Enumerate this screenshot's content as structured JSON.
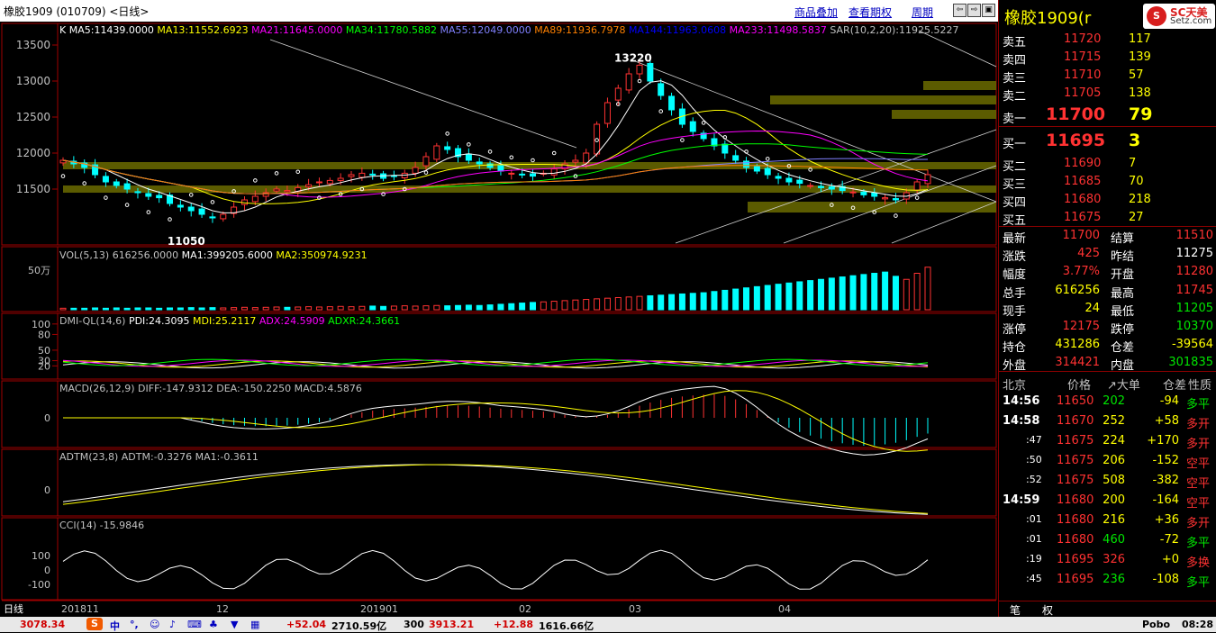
{
  "title": {
    "text": "橡胶1909 (010709) <日线>",
    "links": [
      "商品叠加",
      "查看期权",
      "周期"
    ]
  },
  "chart_data": [
    {
      "type": "candlestick",
      "title": "K",
      "indicators": [
        {
          "name": "MA5",
          "value": "11439.0000",
          "color": "#ffffff"
        },
        {
          "name": "MA13",
          "value": "11552.6923",
          "color": "#ffff00"
        },
        {
          "name": "MA21",
          "value": "11645.0000",
          "color": "#ff00ff"
        },
        {
          "name": "MA34",
          "value": "11780.5882",
          "color": "#00ff00"
        },
        {
          "name": "MA55",
          "value": "12049.0000",
          "color": "#8080ff"
        },
        {
          "name": "MA89",
          "value": "11936.7978",
          "color": "#ff8000"
        },
        {
          "name": "MA144",
          "value": "11963.0608",
          "color": "#0000ff"
        },
        {
          "name": "MA233",
          "value": "11498.5837",
          "color": "#ff00ff"
        },
        {
          "name": "SAR(10,2,20)",
          "value": "11925.5227",
          "color": "#c0c0c0"
        }
      ],
      "yticks": [
        13500,
        13000,
        12500,
        12000,
        11500
      ],
      "ylim": [
        10750,
        13650
      ],
      "annotations": [
        {
          "text": "13220"
        },
        {
          "text": "11050"
        }
      ],
      "x_labels": [
        "日线",
        "201811",
        "12",
        "201901",
        "02",
        "03",
        "04"
      ],
      "closes": [
        11900,
        11850,
        11800,
        11700,
        11600,
        11550,
        11500,
        11450,
        11400,
        11380,
        11300,
        11250,
        11200,
        11150,
        11100,
        11150,
        11250,
        11350,
        11400,
        11450,
        11500,
        11480,
        11520,
        11560,
        11600,
        11620,
        11650,
        11700,
        11720,
        11700,
        11650,
        11680,
        11720,
        11800,
        11950,
        12100,
        12050,
        11950,
        11900,
        11850,
        11800,
        11750,
        11720,
        11700,
        11680,
        11720,
        11780,
        11850,
        11900,
        12000,
        12400,
        12700,
        12900,
        13100,
        13220,
        13000,
        12800,
        12600,
        12400,
        12300,
        12200,
        12100,
        12000,
        11900,
        11800,
        11750,
        11700,
        11650,
        11600,
        11580,
        11550,
        11520,
        11500,
        11480,
        11460,
        11420,
        11400,
        11380,
        11350,
        11450,
        11600,
        11700
      ]
    },
    {
      "type": "bar",
      "title": "VOL(5,13)",
      "indicators": [
        {
          "name": "VOL(5,13)",
          "value": "616256.0000",
          "color": "#c0c0c0"
        },
        {
          "name": "MA1",
          "value": "399205.6000",
          "color": "#ffffff"
        },
        {
          "name": "MA2",
          "value": "350974.9231",
          "color": "#ffff00"
        }
      ],
      "yticks_label": "50万",
      "values": [
        5,
        5,
        5,
        6,
        5,
        6,
        5,
        6,
        6,
        5,
        6,
        6,
        7,
        6,
        7,
        6,
        7,
        8,
        7,
        8,
        9,
        8,
        9,
        10,
        9,
        10,
        11,
        10,
        11,
        12,
        11,
        12,
        13,
        12,
        13,
        14,
        13,
        14,
        15,
        14,
        16,
        18,
        20,
        22,
        24,
        26,
        28,
        30,
        32,
        34,
        36,
        38,
        40,
        42,
        44,
        46,
        48,
        50,
        52,
        54,
        56,
        60,
        64,
        68,
        72,
        76,
        80,
        84,
        88,
        92,
        96,
        100,
        104,
        108,
        112,
        116,
        120,
        124,
        110,
        100,
        120,
        140
      ],
      "ylim": [
        0,
        160
      ]
    },
    {
      "type": "line",
      "title": "DMI-QL(14,6)",
      "indicators": [
        {
          "name": "PDI",
          "value": "24.3095",
          "color": "#ffffff"
        },
        {
          "name": "MDI",
          "value": "25.2117",
          "color": "#ffff00"
        },
        {
          "name": "ADX",
          "value": "24.5909",
          "color": "#ff00ff"
        },
        {
          "name": "ADXR",
          "value": "24.3661",
          "color": "#00ff00"
        }
      ],
      "yticks": [
        100,
        80,
        50,
        30,
        20
      ],
      "ylim": [
        0,
        110
      ]
    },
    {
      "type": "line",
      "title": "MACD(26,12,9)",
      "indicators": [
        {
          "name": "DIFF",
          "value": "-147.9312",
          "color": "#ffffff"
        },
        {
          "name": "DEA",
          "value": "-150.2250",
          "color": "#ffff00"
        },
        {
          "name": "MACD",
          "value": "4.5876",
          "color": "#ff00ff"
        }
      ],
      "yticks": [
        0
      ]
    },
    {
      "type": "line",
      "title": "ADTM(23,8)",
      "indicators": [
        {
          "name": "ADTM",
          "value": "-0.3276",
          "color": "#ffffff"
        },
        {
          "name": "MA1",
          "value": "-0.3611",
          "color": "#ffff00"
        }
      ],
      "yticks": [
        0
      ]
    },
    {
      "type": "line",
      "title": "CCI(14)",
      "indicators": [
        {
          "name": "CCI(14)",
          "value": "-15.9846",
          "color": "#c0c0c0"
        }
      ],
      "yticks": [
        100,
        0,
        -100
      ]
    }
  ],
  "quote": {
    "product": "橡胶1909(r",
    "logo_text": "SC天美",
    "logo_sub": "Setz.com",
    "asks": [
      {
        "label": "卖五",
        "price": "11720",
        "vol": "117"
      },
      {
        "label": "卖四",
        "price": "11715",
        "vol": "139"
      },
      {
        "label": "卖三",
        "price": "11710",
        "vol": "57"
      },
      {
        "label": "卖二",
        "price": "11705",
        "vol": "138"
      },
      {
        "label": "卖一",
        "price": "11700",
        "vol": "79"
      }
    ],
    "bids": [
      {
        "label": "买一",
        "price": "11695",
        "vol": "3"
      },
      {
        "label": "买二",
        "price": "11690",
        "vol": "7"
      },
      {
        "label": "买三",
        "price": "11685",
        "vol": "70"
      },
      {
        "label": "买四",
        "price": "11680",
        "vol": "218"
      },
      {
        "label": "买五",
        "price": "11675",
        "vol": "27"
      }
    ],
    "stats": [
      {
        "l1": "最新",
        "v1": "11700",
        "c1": "red",
        "l2": "结算",
        "v2": "11510",
        "c2": "red"
      },
      {
        "l1": "涨跌",
        "v1": "425",
        "c1": "red",
        "l2": "昨结",
        "v2": "11275",
        "c2": "white"
      },
      {
        "l1": "幅度",
        "v1": "3.77%",
        "c1": "red",
        "l2": "开盘",
        "v2": "11280",
        "c2": "red"
      },
      {
        "l1": "总手",
        "v1": "616256",
        "c1": "yellow",
        "l2": "最高",
        "v2": "11745",
        "c2": "red"
      },
      {
        "l1": "现手",
        "v1": "24",
        "c1": "yellow",
        "l2": "最低",
        "v2": "11205",
        "c2": "green"
      },
      {
        "l1": "涨停",
        "v1": "12175",
        "c1": "red",
        "l2": "跌停",
        "v2": "10370",
        "c2": "green"
      },
      {
        "l1": "持仓",
        "v1": "431286",
        "c1": "yellow",
        "l2": "仓差",
        "v2": "-39564",
        "c2": "yellow"
      },
      {
        "l1": "外盘",
        "v1": "314421",
        "c1": "red",
        "l2": "内盘",
        "v2": "301835",
        "c2": "green"
      }
    ],
    "ticks_header": [
      "北京",
      "价格",
      "↗大单",
      "仓差",
      "性质"
    ],
    "ticks": [
      {
        "time": "14:56",
        "price": "11650",
        "vol": "202",
        "vc": "green",
        "diff": "-94",
        "dc": "yellow",
        "nature": "多平",
        "nc": "green"
      },
      {
        "time": "14:58",
        "price": "11670",
        "vol": "252",
        "vc": "yellow",
        "diff": "+58",
        "dc": "yellow",
        "nature": "多开",
        "nc": "red"
      },
      {
        "time": ":47",
        "price": "11675",
        "vol": "224",
        "vc": "yellow",
        "diff": "+170",
        "dc": "yellow",
        "nature": "多开",
        "nc": "red"
      },
      {
        "time": ":50",
        "price": "11675",
        "vol": "206",
        "vc": "yellow",
        "diff": "-152",
        "dc": "yellow",
        "nature": "空平",
        "nc": "red"
      },
      {
        "time": ":52",
        "price": "11675",
        "vol": "508",
        "vc": "yellow",
        "diff": "-382",
        "dc": "yellow",
        "nature": "空平",
        "nc": "red"
      },
      {
        "time": "14:59",
        "price": "11680",
        "vol": "200",
        "vc": "yellow",
        "diff": "-164",
        "dc": "yellow",
        "nature": "空平",
        "nc": "red"
      },
      {
        "time": ":01",
        "price": "11680",
        "vol": "216",
        "vc": "yellow",
        "diff": "+36",
        "dc": "yellow",
        "nature": "多开",
        "nc": "red"
      },
      {
        "time": ":01",
        "price": "11680",
        "vol": "460",
        "vc": "green",
        "diff": "-72",
        "dc": "yellow",
        "nature": "多平",
        "nc": "green"
      },
      {
        "time": ":19",
        "price": "11695",
        "vol": "326",
        "vc": "red",
        "diff": "+0",
        "dc": "yellow",
        "nature": "多换",
        "nc": "red"
      },
      {
        "time": ":45",
        "price": "11695",
        "vol": "236",
        "vc": "green",
        "diff": "-108",
        "dc": "yellow",
        "nature": "多平",
        "nc": "green"
      }
    ],
    "tabs": [
      "笔",
      "权"
    ]
  },
  "taskbar": {
    "items": [
      {
        "text": "3078.34",
        "color": "#d00000"
      },
      {
        "text": "中",
        "color": "#0000c0"
      },
      {
        "text": "+52.04",
        "color": "#d00000"
      },
      {
        "text": "2710.59亿",
        "color": "#000000"
      },
      {
        "text": "300",
        "color": "#000000"
      },
      {
        "text": "3913.21",
        "color": "#d00000"
      },
      {
        "text": "+12.88",
        "color": "#d00000"
      },
      {
        "text": "1616.66亿",
        "color": "#000000"
      },
      {
        "text": "Pobo",
        "color": "#000000"
      },
      {
        "text": "08:28",
        "color": "#000000"
      }
    ]
  }
}
